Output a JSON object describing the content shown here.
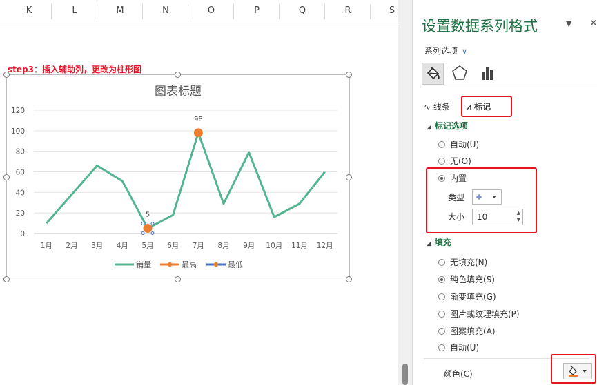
{
  "sheet": {
    "columns": [
      "K",
      "L",
      "M",
      "N",
      "O",
      "P",
      "Q",
      "R",
      "S"
    ],
    "step_label": "step3：插入辅助列，更改为柱形图"
  },
  "chart": {
    "chart_data": {
      "type": "line",
      "title": "图表标题",
      "categories": [
        "1月",
        "2月",
        "3月",
        "4月",
        "5月",
        "6月",
        "7月",
        "8月",
        "9月",
        "10月",
        "11月",
        "12月"
      ],
      "ylim": [
        0,
        120
      ],
      "yticks": [
        0,
        20,
        40,
        60,
        80,
        100,
        120
      ],
      "grid": true,
      "legend_position": "bottom",
      "series": [
        {
          "name": "销量",
          "values": [
            10,
            38,
            66,
            51,
            5,
            18,
            98,
            29,
            79,
            16,
            29,
            60
          ],
          "color": "#52b590"
        },
        {
          "name": "最高",
          "values": [
            null,
            null,
            null,
            null,
            null,
            null,
            98,
            null,
            null,
            null,
            null,
            null
          ],
          "color": "#ed7d31"
        },
        {
          "name": "最低",
          "values": [
            null,
            null,
            null,
            null,
            5,
            null,
            null,
            null,
            null,
            null,
            null,
            null
          ],
          "color": "#4472c4"
        }
      ],
      "data_labels": [
        {
          "index": 6,
          "text": "98"
        },
        {
          "index": 4,
          "text": "5"
        }
      ]
    }
  },
  "pane": {
    "title": "设置数据系列格式",
    "series_options": "系列选项",
    "subtabs": {
      "line": "线条",
      "marker": "标记"
    },
    "marker_options": {
      "heading": "标记选项",
      "auto": "自动(U)",
      "none": "无(O)",
      "builtin": "内置",
      "type_label": "类型",
      "size_label": "大小",
      "size_value": "10"
    },
    "fill": {
      "heading": "填充",
      "none": "无填充(N)",
      "solid": "纯色填充(S)",
      "gradient": "渐变填充(G)",
      "picture": "图片或纹理填充(P)",
      "pattern": "图案填充(A)",
      "auto": "自动(U)",
      "color_label": "颜色(C)"
    },
    "icons": {
      "fill_line": "paint-bucket-icon",
      "effects": "pentagon-icon",
      "series_options": "bar-chart-icon",
      "dropdown": "chevron-down-icon",
      "close": "close-icon"
    },
    "accent_color": "#217346",
    "highlight_color": "#e3141b"
  }
}
